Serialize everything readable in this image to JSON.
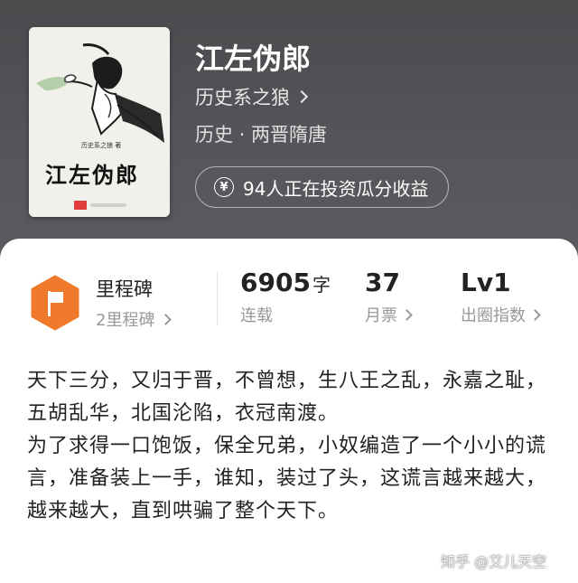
{
  "book": {
    "title": "江左伪郎",
    "author": "历史系之狼",
    "genre": "历史 · 两晋隋唐",
    "invest_text": "94人正在投资瓜分收益",
    "invest_icon": "yen-icon"
  },
  "cover": {
    "author_line": "历史系之狼 著",
    "title": "江左伪郎"
  },
  "stats": {
    "milestone": {
      "title": "里程碑",
      "sub": "2里程碑",
      "icon": "flag-icon",
      "color": "#f07a2b"
    },
    "words": {
      "value": "6905",
      "unit": "字",
      "label": "连载"
    },
    "tickets": {
      "value": "37",
      "label": "月票"
    },
    "level": {
      "value": "Lv1",
      "label": "出圈指数"
    }
  },
  "description": [
    "天下三分，又归于晋，不曾想，生八王之乱，永嘉之耻，五胡乱华，北国沦陷，衣冠南渡。",
    "为了求得一口饱饭，保全兄弟，小奴编造了一个小小的谎言，准备装上一手，谁知，装过了头，这谎言越来越大，越来越大，直到哄骗了整个天下。"
  ],
  "watermark": "知乎 @艾儿天空"
}
